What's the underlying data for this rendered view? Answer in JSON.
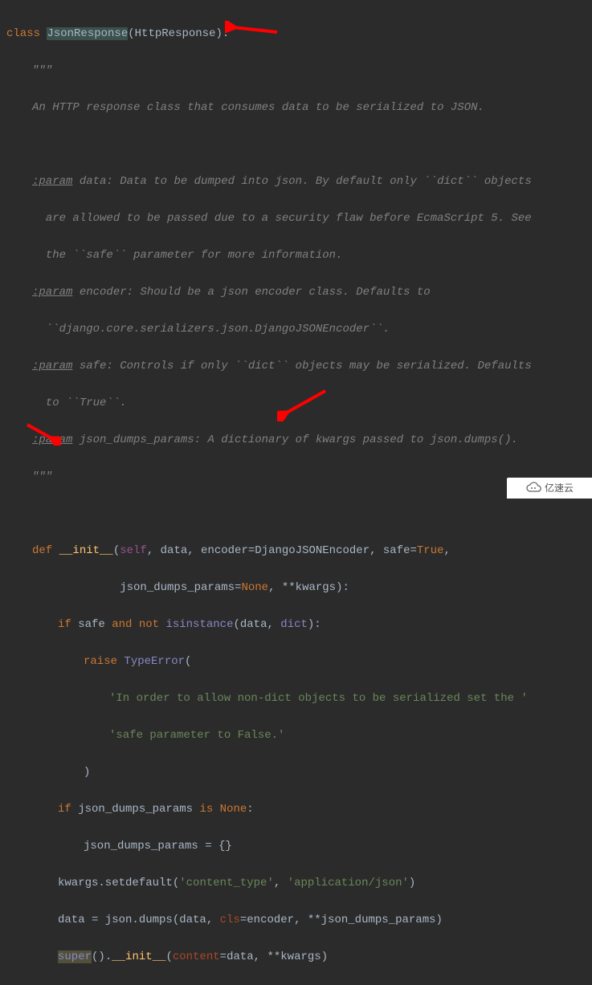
{
  "code": {
    "l1": {
      "kw": "class ",
      "name": "JsonResponse",
      "base": "HttpResponse",
      "colon": ":"
    },
    "doc_open": "\"\"\"",
    "doc_l1": "An HTTP response class that consumes data to be serialized to JSON.",
    "p1_tag": ":param",
    "p1_a": " data: Data to be dumped into json. By default only ``dict`` objects",
    "p1_b": "are allowed to be passed due to a security flaw before EcmaScript 5. See",
    "p1_c": "the ``safe`` parameter for more information.",
    "p2_tag": ":param",
    "p2_a": " encoder: Should be a json encoder class. Defaults to",
    "p2_b": "``django.core.serializers.json.DjangoJSONEncoder``.",
    "p3_tag": ":param",
    "p3_a": " safe: Controls if only ``dict`` objects may be serialized. Defaults",
    "p3_b": "to ``True``.",
    "p4_tag": ":param",
    "p4_a": " json_dumps_params: A dictionary of kwargs passed to json.dumps().",
    "doc_close": "\"\"\"",
    "def_kw": "def ",
    "init_name": "__init__",
    "init_params_a": "(",
    "self_kw": "self",
    "init_params_b": ", data, encoder=DjangoJSONEncoder, safe=",
    "true_kw": "True",
    "init_params_c": ",",
    "init_params_d": "json_dumps_params=",
    "none_kw": "None",
    "init_params_e": ", **kwargs):",
    "if1_a": "if ",
    "if1_b": "safe ",
    "and_kw": "and ",
    "not_kw": "not ",
    "isinstance_kw": "isinstance",
    "if1_c": "(data, ",
    "dict_kw": "dict",
    "if1_d": "):",
    "raise_kw": "raise ",
    "typeerror": "TypeError",
    "raise_paren": "(",
    "err_str1": "'In order to allow non-dict objects to be serialized set the '",
    "err_str2": "'safe parameter to False.'",
    "close_paren": ")",
    "if2_a": "if ",
    "if2_b": "json_dumps_params ",
    "is_kw": "is ",
    "none_kw2": "None",
    "if2_c": ":",
    "assign1": "json_dumps_params = {}",
    "setdef_a": "kwargs.setdefault(",
    "setdef_s1": "'content_type'",
    "setdef_b": ", ",
    "setdef_s2": "'application/json'",
    "setdef_c": ")",
    "dumps_a": "data = json.dumps(data, ",
    "cls_kw": "cls",
    "dumps_b": "=encoder, **json_dumps_params)",
    "super_kw": "super",
    "super_a": "().",
    "super_init": "__init__",
    "super_b": "(",
    "content_kw": "content",
    "super_c": "=data, **kwargs)"
  },
  "watermark": "亿速云",
  "arrows": {
    "color": "#ff0000"
  }
}
